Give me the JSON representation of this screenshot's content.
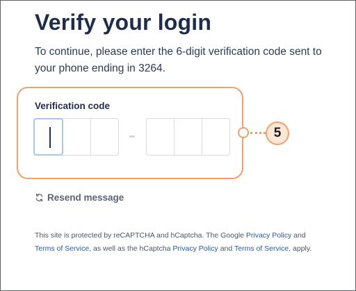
{
  "page": {
    "title": "Verify your login",
    "subtitle": "To continue, please enter the 6-digit verification code sent to your phone ending in 3264."
  },
  "form": {
    "label": "Verification code",
    "digits": [
      "",
      "",
      "",
      "",
      "",
      ""
    ]
  },
  "annotation": {
    "step_number": "5",
    "color": "#f2a06a"
  },
  "resend": {
    "icon": "refresh-icon",
    "label": "Resend message"
  },
  "legal": {
    "part1": "This site is protected by reCAPTCHA and hCaptcha. The Google ",
    "link1": "Privacy Policy",
    "part2": " and ",
    "link2": "Terms of Service",
    "part3": ", as well as the hCaptcha ",
    "link3": "Privacy Policy",
    "part4": " and ",
    "link4": "Terms of Service",
    "part5": ", apply."
  },
  "colors": {
    "heading": "#1f2d4d",
    "link": "#2458b3",
    "input_border": "#d5d9e0",
    "focus_border": "#a9c7ea"
  }
}
